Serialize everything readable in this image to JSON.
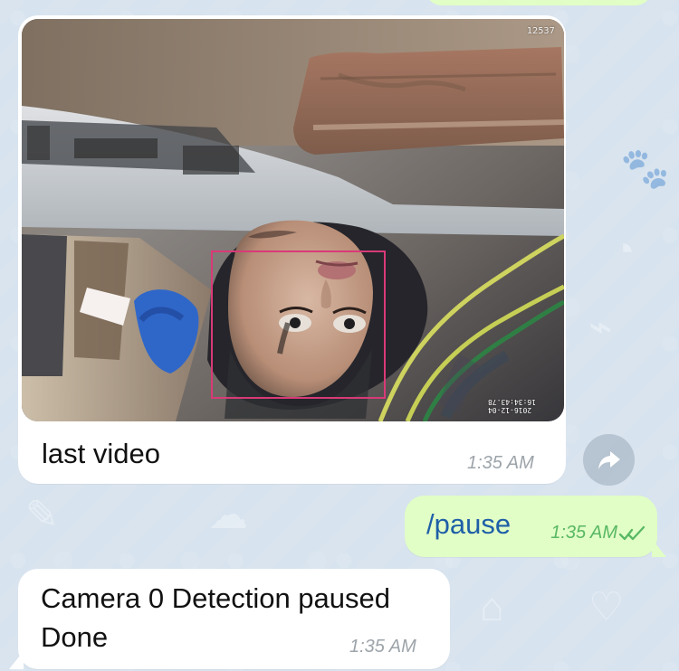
{
  "video_overlay": {
    "counter": "12537",
    "timestamp": "2016-12-04 16:34:43.78"
  },
  "messages": [
    {
      "caption": "last video",
      "time": "1:35 AM"
    },
    {
      "text": "/pause",
      "time": "1:35 AM"
    },
    {
      "line1": "Camera 0 Detection paused",
      "line2": "Done",
      "time": "1:35 AM"
    }
  ],
  "colors": {
    "background": "#d7e3ee",
    "incoming_bubble": "#ffffff",
    "outgoing_bubble": "#e1fec6",
    "command_text": "#1f5fa8",
    "outgoing_time": "#59b864",
    "incoming_time": "#9da4aa",
    "detection_box": "#d93a78"
  },
  "icons": {
    "forward": "forward-icon",
    "read_receipt": "double-check-icon"
  }
}
